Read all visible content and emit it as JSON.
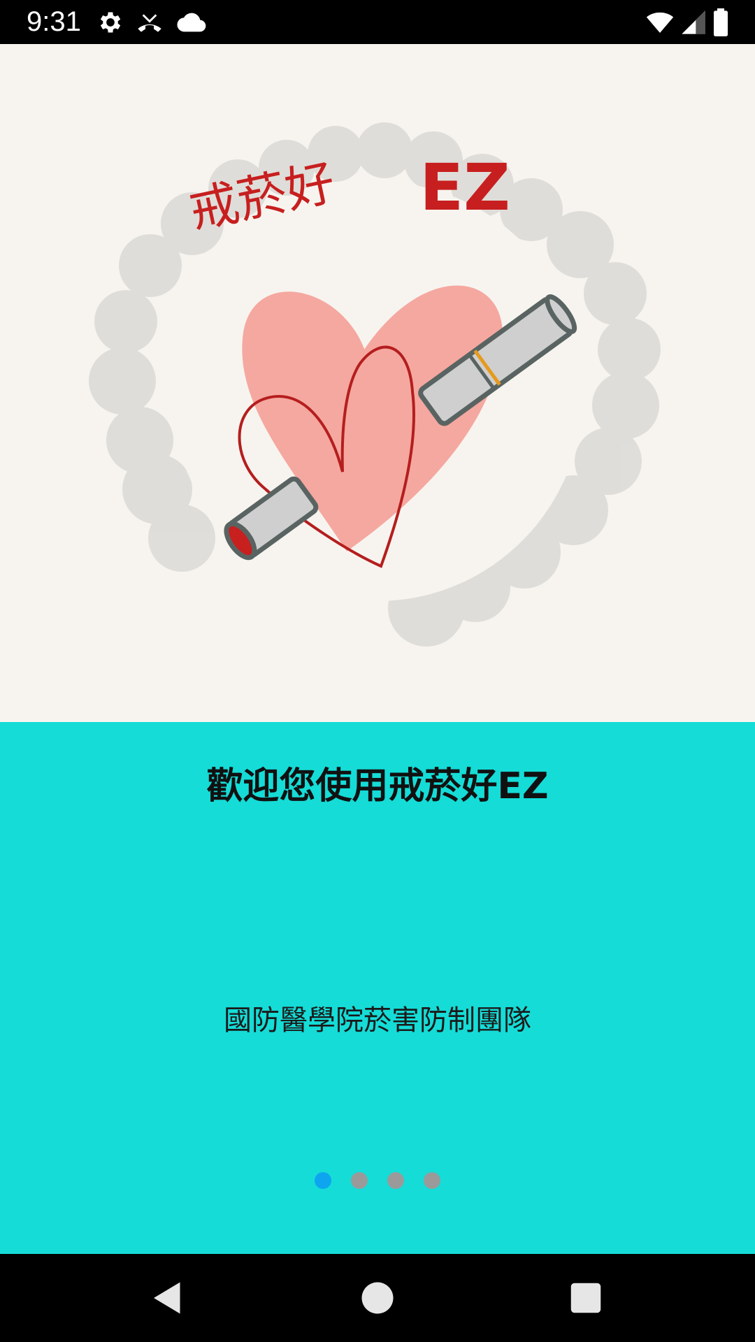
{
  "status_bar": {
    "time": "9:31",
    "left_icons": [
      "settings-icon",
      "missed-call-icon",
      "cloud-icon"
    ],
    "right_icons": [
      "wifi-icon",
      "cellular-signal-icon",
      "battery-icon"
    ]
  },
  "hero": {
    "logo_text_chinese": "戒菸好",
    "logo_text_ez": "EZ",
    "illustration": "heart-with-cigarette-illustration"
  },
  "panel": {
    "title": "歡迎您使用戒菸好EZ",
    "subtitle": "國防醫學院菸害防制團隊",
    "background_color": "#15dcd7"
  },
  "pager": {
    "total": 4,
    "active_index": 0,
    "active_color": "#0ea5f0",
    "inactive_color": "#9a9a9a"
  },
  "nav_bar": {
    "buttons": [
      "back-icon",
      "home-icon",
      "recents-icon"
    ]
  }
}
